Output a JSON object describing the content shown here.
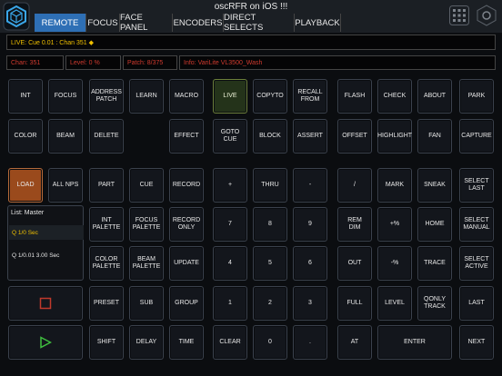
{
  "app": {
    "title": "oscRFR on iOS !!!"
  },
  "tabs": [
    {
      "label": "REMOTE",
      "active": true
    },
    {
      "label": "FOCUS",
      "active": false
    },
    {
      "label": "FACE PANEL",
      "active": false
    },
    {
      "label": "ENCODERS",
      "active": false
    },
    {
      "label": "DIRECT SELECTS",
      "active": false
    },
    {
      "label": "PLAYBACK",
      "active": false
    }
  ],
  "command_line": {
    "text": "LIVE: Cue  0.01 : Chan 351 ◆"
  },
  "status": {
    "chan": "Chan: 351",
    "level": "Level: 0 %",
    "patch": "Patch: 8/375",
    "info": "Info:  VariLite VL3500_Wash"
  },
  "list": {
    "title": "List:   Master",
    "rows": [
      {
        "text": "Q  1/0 Sec",
        "selected": true
      },
      {
        "text": "Q  1/0.01 3.00 Sec",
        "selected": false
      }
    ]
  },
  "buttons": {
    "int": "INT",
    "focus": "FOCUS",
    "address_patch": "ADDRESS\nPATCH",
    "learn": "LEARN",
    "macro": "MACRO",
    "live": "LIVE",
    "copyto": "COPYTO",
    "recall_from": "RECALL\nFROM",
    "flash": "FLASH",
    "check": "CHECK",
    "about": "ABOUT",
    "park": "PARK",
    "color": "COLOR",
    "beam": "BEAM",
    "delete": "DELETE",
    "effect": "EFFECT",
    "goto_cue": "GOTO\nCUE",
    "block": "BLOCK",
    "assert": "ASSERT",
    "offset": "OFFSET",
    "highlight": "HIGHLIGHT",
    "fan": "FAN",
    "capture": "CAPTURE",
    "load": "LOAD",
    "all_nps": "ALL NPS",
    "part": "PART",
    "cue": "CUE",
    "record": "RECORD",
    "plus": "+",
    "thru": "THRU",
    "minus": "-",
    "slash": "/",
    "mark": "MARK",
    "sneak": "SNEAK",
    "select_last": "SELECT\nLAST",
    "int_palette": "INT\nPALETTE",
    "focus_palette": "FOCUS\nPALETTE",
    "record_only": "RECORD\nONLY",
    "seven": "7",
    "eight": "8",
    "nine": "9",
    "rem_dim": "REM\nDIM",
    "plus_pct": "+%",
    "home": "HOME",
    "select_manual": "SELECT\nMANUAL",
    "color_palette": "COLOR\nPALETTE",
    "beam_palette": "BEAM\nPALETTE",
    "update": "UPDATE",
    "four": "4",
    "five": "5",
    "six": "6",
    "out": "OUT",
    "minus_pct": "-%",
    "trace": "TRACE",
    "select_active": "SELECT\nACTIVE",
    "preset": "PRESET",
    "sub": "SUB",
    "group": "GROUP",
    "one": "1",
    "two": "2",
    "three": "3",
    "full": "FULL",
    "level": "LEVEL",
    "qonly_track": "QONLY\nTRACK",
    "last": "LAST",
    "shift": "SHIFT",
    "delay": "DELAY",
    "time": "TIME",
    "clear": "CLEAR",
    "zero": "0",
    "dot": ".",
    "at": "AT",
    "enter": "ENTER",
    "next": "NEXT"
  },
  "colors": {
    "accent": "#2e6fb5",
    "live": "#6b7f3a",
    "load": "#9a4a1c",
    "command_text": "#f0c000",
    "status_text": "#d03a2e",
    "logo": "#3aa6e8"
  }
}
